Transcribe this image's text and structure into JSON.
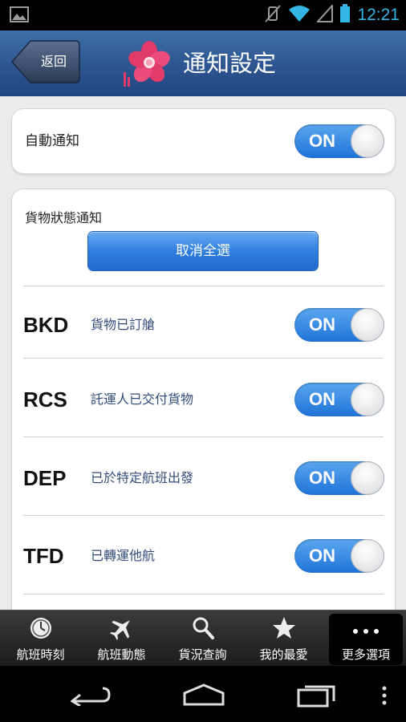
{
  "status_bar": {
    "time": "12:21"
  },
  "header": {
    "back_label": "返回",
    "title": "通知設定"
  },
  "auto_notify": {
    "label": "自動通知",
    "toggle": "ON"
  },
  "cargo_section": {
    "title": "貨物狀態通知",
    "clear_all_label": "取消全選",
    "items": [
      {
        "code": "BKD",
        "desc": "貨物已訂艙",
        "toggle": "ON"
      },
      {
        "code": "RCS",
        "desc": "託運人已交付貨物",
        "toggle": "ON"
      },
      {
        "code": "DEP",
        "desc": "已於特定航班出發",
        "toggle": "ON"
      },
      {
        "code": "TFD",
        "desc": "已轉運他航",
        "toggle": "ON"
      }
    ]
  },
  "tabbar": {
    "tabs": [
      {
        "label": "航班時刻",
        "icon": "clock-icon"
      },
      {
        "label": "航班動態",
        "icon": "plane-icon"
      },
      {
        "label": "貨況查詢",
        "icon": "search-icon"
      },
      {
        "label": "我的最愛",
        "icon": "star-icon"
      },
      {
        "label": "更多選項",
        "icon": "more-icon"
      }
    ],
    "active_index": 4
  },
  "colors": {
    "header": "#2d5590",
    "toggle_on": "#1f73d8",
    "accent": "#33b5e5"
  }
}
